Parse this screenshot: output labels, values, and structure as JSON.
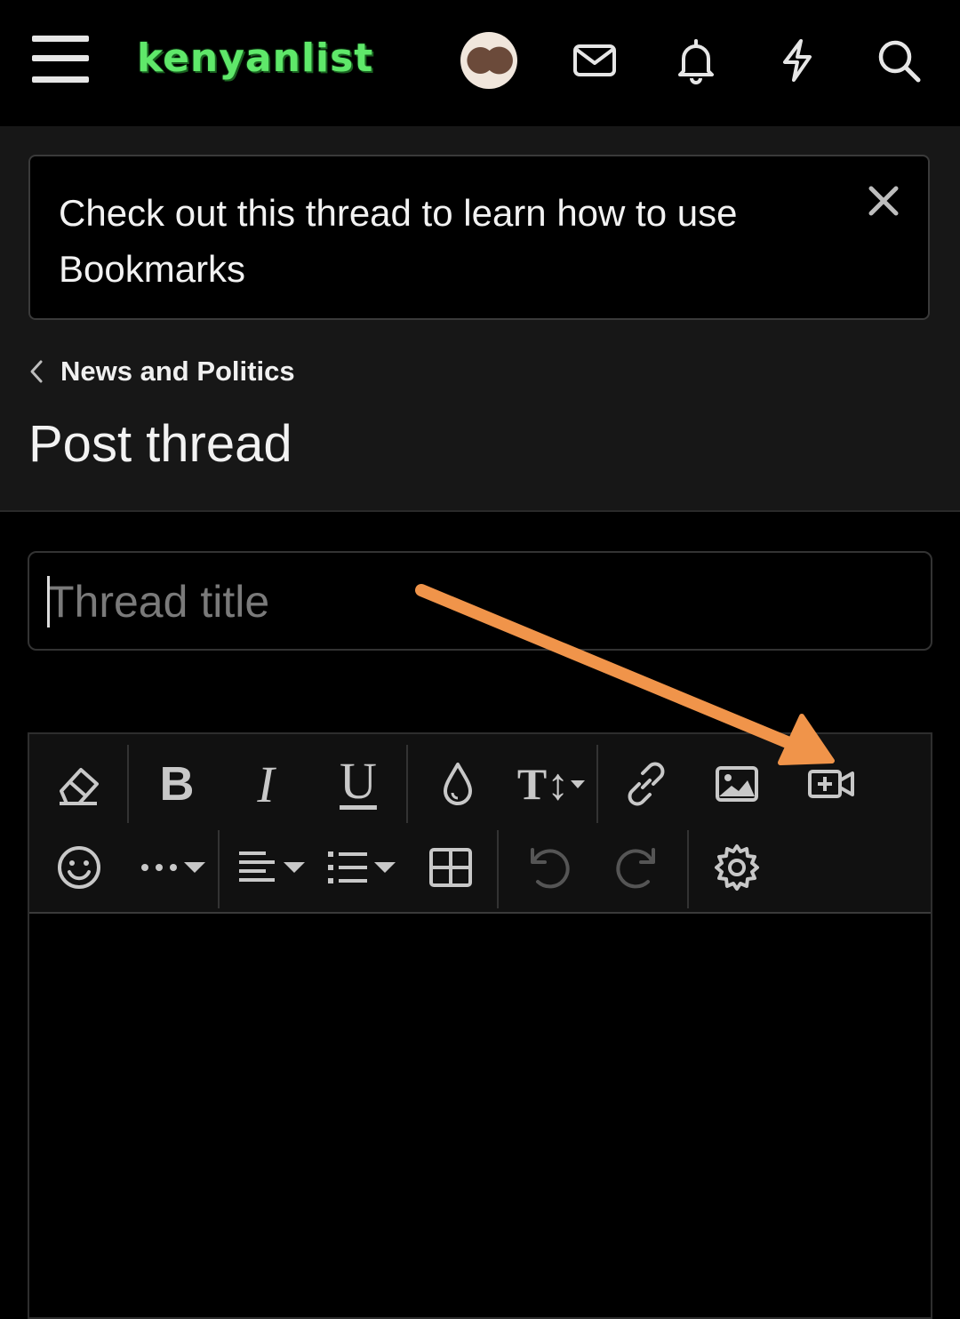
{
  "header": {
    "logo_text": "kenyanlist",
    "logo_color": "#5fe86a",
    "icons": [
      "menu-icon",
      "avatar",
      "mail-icon",
      "bell-icon",
      "lightning-icon",
      "search-icon"
    ]
  },
  "notice": {
    "text": "Check out this thread to learn how to use Bookmarks",
    "close_icon": "close-icon"
  },
  "breadcrumb": {
    "label": "News and Politics"
  },
  "page": {
    "title": "Post thread"
  },
  "form": {
    "thread_title_placeholder": "Thread title",
    "thread_title_value": ""
  },
  "toolbar": {
    "row1": [
      "eraser-icon",
      "bold-icon",
      "italic-icon",
      "underline-icon",
      "text-color-icon",
      "font-size-icon",
      "link-icon",
      "image-icon",
      "insert-video-icon"
    ],
    "row2": [
      "smile-icon",
      "more-options-icon",
      "align-icon",
      "list-icon",
      "table-icon",
      "undo-icon",
      "redo-icon",
      "settings-icon"
    ],
    "bold_glyph": "B",
    "italic_glyph": "I",
    "underline_glyph": "U",
    "font_size_glyph": "T↕"
  },
  "annotation": {
    "arrow_color": "#f0944a",
    "points_to": "insert-video-icon"
  }
}
